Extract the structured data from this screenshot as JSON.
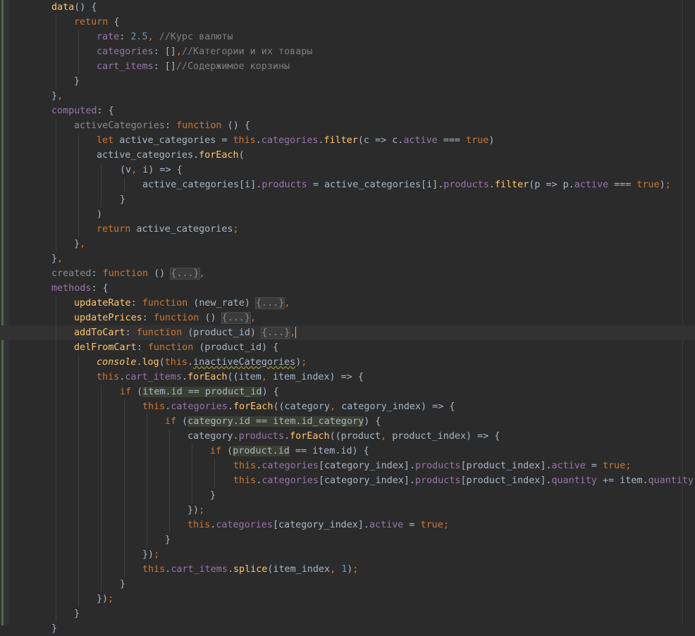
{
  "editor": {
    "language": "javascript",
    "theme": {
      "background": "#2b2b2b",
      "keyword": "#cc7832",
      "property": "#9876aa",
      "function": "#ffc66d",
      "number": "#6897bb",
      "comment": "#808080"
    },
    "lines": [
      {
        "indent": 1,
        "tokens": [
          {
            "t": "data",
            "c": "fn"
          },
          {
            "t": "() {"
          }
        ]
      },
      {
        "indent": 2,
        "tokens": [
          {
            "t": "return",
            "c": "kw"
          },
          {
            "t": " {"
          }
        ]
      },
      {
        "indent": 3,
        "tokens": [
          {
            "t": "rate",
            "c": "prop"
          },
          {
            "t": ": "
          },
          {
            "t": "2.5",
            "c": "num"
          },
          {
            "t": ", ",
            "c": "kw"
          },
          {
            "t": "//Курс валюты",
            "c": "comment"
          }
        ]
      },
      {
        "indent": 3,
        "tokens": [
          {
            "t": "categories",
            "c": "prop"
          },
          {
            "t": ": []"
          },
          {
            "t": ",",
            "c": "kw"
          },
          {
            "t": "//Категории и их товары",
            "c": "comment"
          }
        ]
      },
      {
        "indent": 3,
        "tokens": [
          {
            "t": "cart_items",
            "c": "prop"
          },
          {
            "t": ": []"
          },
          {
            "t": "//Содержимое корзины",
            "c": "comment"
          }
        ]
      },
      {
        "indent": 2,
        "tokens": [
          {
            "t": "}"
          }
        ]
      },
      {
        "indent": 1,
        "tokens": [
          {
            "t": "}"
          },
          {
            "t": ",",
            "c": "kw"
          }
        ]
      },
      {
        "indent": 1,
        "tokens": [
          {
            "t": "computed",
            "c": "prop"
          },
          {
            "t": ": {"
          }
        ]
      },
      {
        "indent": 2,
        "tokens": [
          {
            "t": "activeCategories",
            "c": "gray"
          },
          {
            "t": ": "
          },
          {
            "t": "function",
            "c": "kw"
          },
          {
            "t": " () {"
          }
        ]
      },
      {
        "indent": 3,
        "tokens": [
          {
            "t": "let",
            "c": "kw"
          },
          {
            "t": " active_categories = "
          },
          {
            "t": "this",
            "c": "kw"
          },
          {
            "t": "."
          },
          {
            "t": "categories",
            "c": "prop"
          },
          {
            "t": "."
          },
          {
            "t": "filter",
            "c": "fn"
          },
          {
            "t": "(c => c."
          },
          {
            "t": "active",
            "c": "prop"
          },
          {
            "t": " === "
          },
          {
            "t": "true",
            "c": "kw"
          },
          {
            "t": ")"
          }
        ]
      },
      {
        "indent": 3,
        "tokens": [
          {
            "t": "active_categories."
          },
          {
            "t": "forEach",
            "c": "fn"
          },
          {
            "t": "("
          }
        ]
      },
      {
        "indent": 4,
        "tokens": [
          {
            "t": "(v"
          },
          {
            "t": ", ",
            "c": "kw"
          },
          {
            "t": "i) => {"
          }
        ]
      },
      {
        "indent": 5,
        "tokens": [
          {
            "t": "active_categories[i]."
          },
          {
            "t": "products",
            "c": "prop"
          },
          {
            "t": " = active_categories[i]."
          },
          {
            "t": "products",
            "c": "prop"
          },
          {
            "t": "."
          },
          {
            "t": "filter",
            "c": "fn"
          },
          {
            "t": "(p => p."
          },
          {
            "t": "active",
            "c": "prop"
          },
          {
            "t": " === "
          },
          {
            "t": "true",
            "c": "kw"
          },
          {
            "t": ")"
          },
          {
            "t": ";",
            "c": "kw"
          }
        ]
      },
      {
        "indent": 4,
        "tokens": [
          {
            "t": "}"
          }
        ]
      },
      {
        "indent": 3,
        "tokens": [
          {
            "t": ")"
          }
        ]
      },
      {
        "indent": 3,
        "tokens": [
          {
            "t": "return",
            "c": "kw"
          },
          {
            "t": " active_categories"
          },
          {
            "t": ";",
            "c": "kw"
          }
        ]
      },
      {
        "indent": 2,
        "tokens": [
          {
            "t": "}"
          },
          {
            "t": ",",
            "c": "kw"
          }
        ]
      },
      {
        "indent": 1,
        "tokens": [
          {
            "t": "}"
          },
          {
            "t": ",",
            "c": "kw"
          }
        ]
      },
      {
        "indent": 1,
        "tokens": [
          {
            "t": "created",
            "c": "gray"
          },
          {
            "t": ": "
          },
          {
            "t": "function",
            "c": "kw"
          },
          {
            "t": " () "
          },
          {
            "t": "{...}",
            "c": "fold"
          },
          {
            "t": ",",
            "c": "kw"
          }
        ]
      },
      {
        "indent": 1,
        "tokens": [
          {
            "t": "methods",
            "c": "prop"
          },
          {
            "t": ": {"
          }
        ]
      },
      {
        "indent": 2,
        "tokens": [
          {
            "t": "updateRate",
            "c": "fn"
          },
          {
            "t": ": "
          },
          {
            "t": "function",
            "c": "kw"
          },
          {
            "t": " (new_rate) "
          },
          {
            "t": "{...}",
            "c": "fold"
          },
          {
            "t": ",",
            "c": "kw"
          }
        ]
      },
      {
        "indent": 2,
        "tokens": [
          {
            "t": "updatePrices",
            "c": "fn"
          },
          {
            "t": ": "
          },
          {
            "t": "function",
            "c": "kw"
          },
          {
            "t": " () "
          },
          {
            "t": "{...}",
            "c": "fold"
          },
          {
            "t": ",",
            "c": "kw"
          }
        ]
      },
      {
        "indent": 2,
        "current": true,
        "tokens": [
          {
            "t": "addToCart",
            "c": "fn"
          },
          {
            "t": ": "
          },
          {
            "t": "function",
            "c": "kw"
          },
          {
            "t": " (product_id) "
          },
          {
            "t": "{...}",
            "c": "fold"
          },
          {
            "t": ",",
            "c": "kw"
          },
          {
            "t": "",
            "c": "caret"
          }
        ]
      },
      {
        "indent": 2,
        "tokens": [
          {
            "t": "delFromCart",
            "c": "fn"
          },
          {
            "t": ": "
          },
          {
            "t": "function",
            "c": "kw"
          },
          {
            "t": " (product_id) {"
          }
        ]
      },
      {
        "indent": 3,
        "tokens": [
          {
            "t": "console",
            "c": "italic"
          },
          {
            "t": "."
          },
          {
            "t": "log",
            "c": "fn"
          },
          {
            "t": "("
          },
          {
            "t": "this",
            "c": "kw"
          },
          {
            "t": "."
          },
          {
            "t": "inactiveCategories",
            "c": "warn"
          },
          {
            "t": ")"
          },
          {
            "t": ";",
            "c": "kw"
          }
        ]
      },
      {
        "indent": 3,
        "tokens": [
          {
            "t": "this",
            "c": "kw"
          },
          {
            "t": "."
          },
          {
            "t": "cart_items",
            "c": "prop"
          },
          {
            "t": "."
          },
          {
            "t": "forEach",
            "c": "fn"
          },
          {
            "t": "((item"
          },
          {
            "t": ", ",
            "c": "kw"
          },
          {
            "t": "item_index) => {"
          }
        ]
      },
      {
        "indent": 4,
        "tokens": [
          {
            "t": "if",
            "c": "kw"
          },
          {
            "t": " ("
          },
          {
            "t": "item.id == product_id",
            "c": "hl"
          },
          {
            "t": ") {"
          }
        ]
      },
      {
        "indent": 5,
        "tokens": [
          {
            "t": "this",
            "c": "kw"
          },
          {
            "t": "."
          },
          {
            "t": "categories",
            "c": "prop"
          },
          {
            "t": "."
          },
          {
            "t": "forEach",
            "c": "fn"
          },
          {
            "t": "((category"
          },
          {
            "t": ", ",
            "c": "kw"
          },
          {
            "t": "category_index) => {"
          }
        ]
      },
      {
        "indent": 6,
        "tokens": [
          {
            "t": "if",
            "c": "kw"
          },
          {
            "t": " ("
          },
          {
            "t": "category.id == item.id_category",
            "c": "hl"
          },
          {
            "t": ") {"
          }
        ]
      },
      {
        "indent": 7,
        "tokens": [
          {
            "t": "category."
          },
          {
            "t": "products",
            "c": "prop"
          },
          {
            "t": "."
          },
          {
            "t": "forEach",
            "c": "fn"
          },
          {
            "t": "((product"
          },
          {
            "t": ", ",
            "c": "kw"
          },
          {
            "t": "product_index) => {"
          }
        ]
      },
      {
        "indent": 8,
        "tokens": [
          {
            "t": "if",
            "c": "kw"
          },
          {
            "t": " ("
          },
          {
            "t": "product.id",
            "c": "hl"
          },
          {
            "t": " == item.id) {"
          }
        ]
      },
      {
        "indent": 9,
        "tokens": [
          {
            "t": "this",
            "c": "kw"
          },
          {
            "t": "."
          },
          {
            "t": "categories",
            "c": "prop"
          },
          {
            "t": "[category_index]."
          },
          {
            "t": "products",
            "c": "prop"
          },
          {
            "t": "[product_index]."
          },
          {
            "t": "active",
            "c": "prop"
          },
          {
            "t": " = "
          },
          {
            "t": "true",
            "c": "kw"
          },
          {
            "t": ";",
            "c": "kw"
          }
        ]
      },
      {
        "indent": 9,
        "tokens": [
          {
            "t": "this",
            "c": "kw"
          },
          {
            "t": "."
          },
          {
            "t": "categories",
            "c": "prop"
          },
          {
            "t": "[category_index]."
          },
          {
            "t": "products",
            "c": "prop"
          },
          {
            "t": "[product_index]."
          },
          {
            "t": "quantity",
            "c": "prop"
          },
          {
            "t": " += item."
          },
          {
            "t": "quantity",
            "c": "prop"
          },
          {
            "t": ";",
            "c": "kw"
          }
        ]
      },
      {
        "indent": 8,
        "tokens": [
          {
            "t": "}"
          }
        ]
      },
      {
        "indent": 7,
        "tokens": [
          {
            "t": "})"
          },
          {
            "t": ";",
            "c": "kw"
          }
        ]
      },
      {
        "indent": 7,
        "tokens": [
          {
            "t": "this",
            "c": "kw"
          },
          {
            "t": "."
          },
          {
            "t": "categories",
            "c": "prop"
          },
          {
            "t": "[category_index]."
          },
          {
            "t": "active",
            "c": "prop"
          },
          {
            "t": " = "
          },
          {
            "t": "true",
            "c": "kw"
          },
          {
            "t": ";",
            "c": "kw"
          }
        ]
      },
      {
        "indent": 6,
        "tokens": [
          {
            "t": "}"
          }
        ]
      },
      {
        "indent": 5,
        "tokens": [
          {
            "t": "})"
          },
          {
            "t": ";",
            "c": "kw"
          }
        ]
      },
      {
        "indent": 5,
        "tokens": [
          {
            "t": "this",
            "c": "kw"
          },
          {
            "t": "."
          },
          {
            "t": "cart_items",
            "c": "prop"
          },
          {
            "t": "."
          },
          {
            "t": "splice",
            "c": "fn"
          },
          {
            "t": "(item_index"
          },
          {
            "t": ", ",
            "c": "kw"
          },
          {
            "t": "1",
            "c": "num"
          },
          {
            "t": ")"
          },
          {
            "t": ";",
            "c": "kw"
          }
        ]
      },
      {
        "indent": 4,
        "tokens": [
          {
            "t": "}"
          }
        ]
      },
      {
        "indent": 3,
        "tokens": [
          {
            "t": "})"
          },
          {
            "t": ";",
            "c": "kw"
          }
        ]
      },
      {
        "indent": 2,
        "tokens": [
          {
            "t": "}"
          }
        ]
      },
      {
        "indent": 1,
        "tokens": [
          {
            "t": "}"
          }
        ]
      }
    ]
  }
}
